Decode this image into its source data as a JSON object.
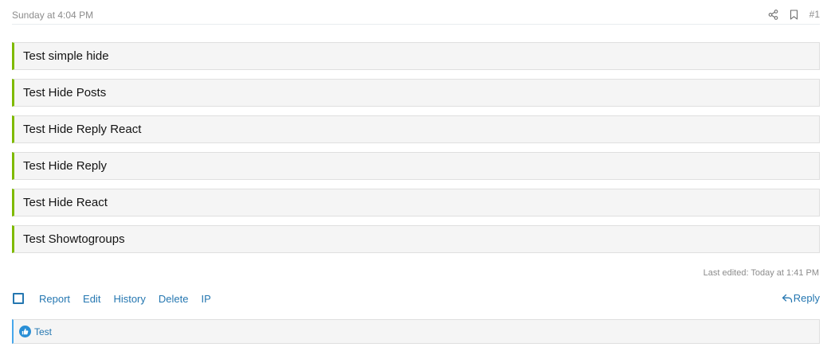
{
  "post": {
    "date": "Sunday at 4:04 PM",
    "number": "#1",
    "header_icons": [
      "share-icon",
      "bookmark-icon"
    ]
  },
  "hidden_blocks": [
    {
      "label": "Test simple hide"
    },
    {
      "label": "Test Hide Posts"
    },
    {
      "label": "Test Hide Reply React"
    },
    {
      "label": "Test Hide Reply"
    },
    {
      "label": "Test Hide React"
    },
    {
      "label": "Test Showtogroups"
    }
  ],
  "last_edited": "Last edited: Today at 1:41 PM",
  "actions": {
    "report": "Report",
    "edit": "Edit",
    "history": "History",
    "delete": "Delete",
    "ip": "IP",
    "reply": "Reply"
  },
  "reactions": {
    "icon": "like-icon",
    "user": "Test"
  },
  "colors": {
    "hide_accent": "#7fba00",
    "link": "#2577b1",
    "reaction_accent": "#47a7eb"
  }
}
